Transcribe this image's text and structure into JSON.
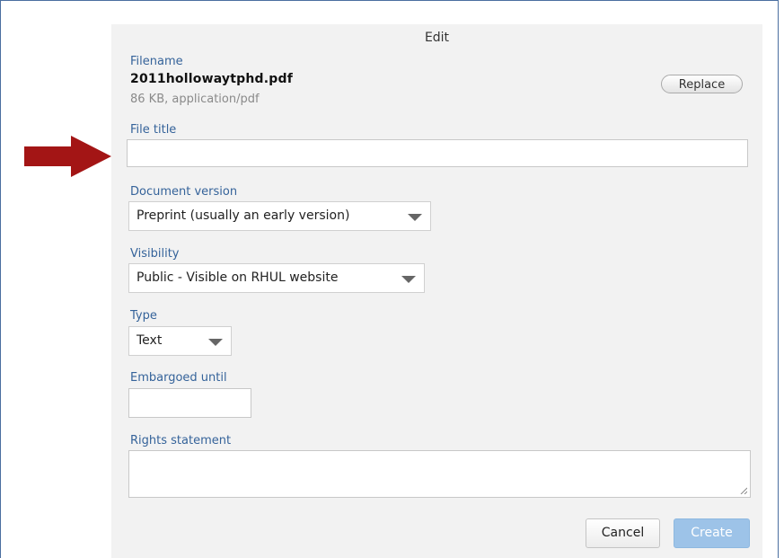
{
  "dialog": {
    "title": "Edit",
    "filename_label": "Filename",
    "filename_value": "2011hollowaytphd.pdf",
    "file_meta": "86 KB, application/pdf",
    "replace_label": "Replace",
    "file_title_label": "File title",
    "file_title_value": "",
    "document_version_label": "Document version",
    "document_version_value": "Preprint (usually an early version)",
    "visibility_label": "Visibility",
    "visibility_value": "Public - Visible on RHUL website",
    "type_label": "Type",
    "type_value": "Text",
    "embargoed_label": "Embargoed until",
    "embargoed_value": "",
    "rights_label": "Rights statement",
    "rights_value": "",
    "cancel_label": "Cancel",
    "create_label": "Create"
  },
  "annotation": {
    "arrow_color": "#a31515",
    "arrow_icon": "right-arrow-icon"
  }
}
